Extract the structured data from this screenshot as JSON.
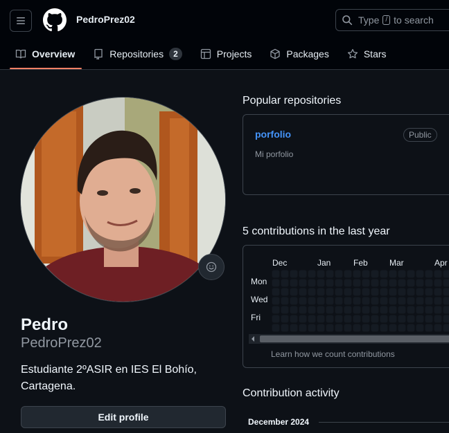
{
  "header": {
    "username": "PedroPrez02",
    "search_prefix": "Type",
    "search_key": "/",
    "search_suffix": "to search"
  },
  "tabs": [
    {
      "label": "Overview",
      "icon": "book-icon"
    },
    {
      "label": "Repositories",
      "icon": "repo-icon",
      "count": "2"
    },
    {
      "label": "Projects",
      "icon": "table-icon"
    },
    {
      "label": "Packages",
      "icon": "package-icon"
    },
    {
      "label": "Stars",
      "icon": "star-icon"
    }
  ],
  "profile": {
    "name": "Pedro",
    "login": "PedroPrez02",
    "bio": "Estudiante 2ºASIR en IES El Bohío, Cartagena.",
    "edit_label": "Edit profile"
  },
  "popular": {
    "title": "Popular repositories",
    "repos": [
      {
        "name": "porfolio",
        "visibility": "Public",
        "description": "Mi porfolio"
      }
    ]
  },
  "contributions": {
    "title": "5 contributions in the last year",
    "months": [
      "Dec",
      "Jan",
      "Feb",
      "Mar",
      "Apr"
    ],
    "days": [
      "Mon",
      "Wed",
      "Fri"
    ],
    "learn_link": "Learn how we count contributions"
  },
  "activity": {
    "title": "Contribution activity",
    "period": "December 2024"
  },
  "colors": {
    "accent_underline": "#f78166",
    "link": "#4493f8",
    "background": "#0d1117",
    "empty_cell": "#151b23"
  }
}
